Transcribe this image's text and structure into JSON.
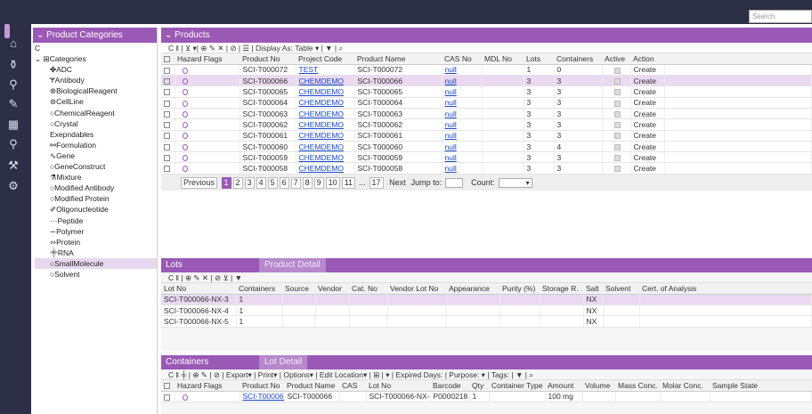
{
  "search_placeholder": "Search",
  "categories": {
    "title": "Product Categories",
    "root": "Categories",
    "items": [
      {
        "label": "ADC",
        "icon": "adc-icon"
      },
      {
        "label": "Antibody",
        "icon": "antibody-icon"
      },
      {
        "label": "BiologicalReagent",
        "icon": "reagent-icon"
      },
      {
        "label": "CellLine",
        "icon": "cell-icon"
      },
      {
        "label": "ChemicalReagent",
        "icon": "circle-icon"
      },
      {
        "label": "Crystal",
        "icon": "circle-icon"
      },
      {
        "label": "Exepndables",
        "icon": ""
      },
      {
        "label": "Formulation",
        "icon": "formulation-icon"
      },
      {
        "label": "Gene",
        "icon": "gene-icon"
      },
      {
        "label": "GeneConstruct",
        "icon": "circle-icon"
      },
      {
        "label": "Mixture",
        "icon": "mixture-icon"
      },
      {
        "label": "Modified Antibody",
        "icon": "circle-icon"
      },
      {
        "label": "Modified Protein",
        "icon": "circle-icon"
      },
      {
        "label": "Oligonucleotide",
        "icon": "oligo-icon"
      },
      {
        "label": "Peptide",
        "icon": "peptide-icon"
      },
      {
        "label": "Polymer",
        "icon": "polymer-icon"
      },
      {
        "label": "Protein",
        "icon": "protein-icon"
      },
      {
        "label": "RNA",
        "icon": "rna-icon"
      },
      {
        "label": "SmallMolecule",
        "icon": "circle-icon"
      },
      {
        "label": "Solvent",
        "icon": "circle-icon"
      }
    ]
  },
  "products": {
    "title": "Products",
    "display_as_label": "Display As:",
    "display_as_value": "Table",
    "columns": [
      "Hazard Flags",
      "Product No",
      "Project Code",
      "Product Name",
      "CAS No",
      "MDL No",
      "Lots",
      "Containers",
      "Active",
      "Action"
    ],
    "rows": [
      {
        "no": "SCI-T000072",
        "project": "TEST",
        "name": "SCI-T000072",
        "cas": "null",
        "lots": "1",
        "containers": "0",
        "action": "Create"
      },
      {
        "no": "SCI-T000066",
        "project": "CHEMDEMO",
        "name": "SCI-T000066",
        "cas": "null",
        "lots": "3",
        "containers": "3",
        "action": "Create"
      },
      {
        "no": "SCI-T000065",
        "project": "CHEMDEMO",
        "name": "SCI-T000065",
        "cas": "null",
        "lots": "3",
        "containers": "3",
        "action": "Create"
      },
      {
        "no": "SCI-T000064",
        "project": "CHEMDEMO",
        "name": "SCI-T000064",
        "cas": "null",
        "lots": "3",
        "containers": "3",
        "action": "Create"
      },
      {
        "no": "SCI-T000063",
        "project": "CHEMDEMO",
        "name": "SCI-T000063",
        "cas": "null",
        "lots": "3",
        "containers": "3",
        "action": "Create"
      },
      {
        "no": "SCI-T000062",
        "project": "CHEMDEMO",
        "name": "SCI-T000062",
        "cas": "null",
        "lots": "3",
        "containers": "3",
        "action": "Create"
      },
      {
        "no": "SCI-T000061",
        "project": "CHEMDEMO",
        "name": "SCI-T000061",
        "cas": "null",
        "lots": "3",
        "containers": "3",
        "action": "Create"
      },
      {
        "no": "SCI-T000060",
        "project": "CHEMDEMO",
        "name": "SCI-T000060",
        "cas": "null",
        "lots": "3",
        "containers": "4",
        "action": "Create"
      },
      {
        "no": "SCI-T000059",
        "project": "CHEMDEMO",
        "name": "SCI-T000059",
        "cas": "null",
        "lots": "3",
        "containers": "3",
        "action": "Create"
      },
      {
        "no": "SCI-T000058",
        "project": "CHEMDEMO",
        "name": "SCI-T000058",
        "cas": "null",
        "lots": "3",
        "containers": "3",
        "action": "Create"
      }
    ],
    "pager": {
      "previous": "Previous",
      "pages": [
        "1",
        "2",
        "3",
        "4",
        "5",
        "6",
        "7",
        "8",
        "9",
        "10",
        "11",
        "...",
        "17"
      ],
      "next": "Next",
      "jump_to": "Jump to:",
      "count": "Count:"
    }
  },
  "lots": {
    "tab1": "Lots",
    "tab2": "Product Detail",
    "columns": [
      "Lot No",
      "Containers",
      "Source",
      "Vendor",
      "Cat. No",
      "Vendor Lot No",
      "Appearance",
      "Purity (%)",
      "Storage R.",
      "Salt",
      "Solvent",
      "Cert. of Analysis"
    ],
    "rows": [
      {
        "lot": "SCI-T000066-NX-3",
        "containers": "1",
        "salt": "NX"
      },
      {
        "lot": "SCI-T000066-NX-4",
        "containers": "1",
        "salt": "NX"
      },
      {
        "lot": "SCI-T000066-NX-5",
        "containers": "1",
        "salt": "NX"
      }
    ]
  },
  "containers": {
    "tab1": "Containers",
    "tab2": "Lot Detail",
    "toolbar": "C ‖ ╪ | ⊕ ✎ | ⊘ | Export▾ | Print▾ | Options▾ | Edit Location▾ | ⊞ | ▾ | Expired Days: | Purpose: ▾ | Tags: | ▼ | ⌕",
    "columns": [
      "Hazard Flags",
      "Product No",
      "Product Name",
      "CAS",
      "Lot No",
      "Barcode",
      "Qty",
      "Container Type",
      "Amount",
      "Volume",
      "Mass Conc.",
      "Molar Conc.",
      "Sample State"
    ],
    "row": {
      "product_no": "SCI-T000066",
      "product_name": "SCI-T000066",
      "lot": "SCI-T000066-NX-3",
      "barcode": "P0000218",
      "qty": "1",
      "amount": "100 mg"
    }
  },
  "colors": {
    "accent": "#9b59b6",
    "nav": "#2c2f45",
    "link": "#1a47c9"
  }
}
